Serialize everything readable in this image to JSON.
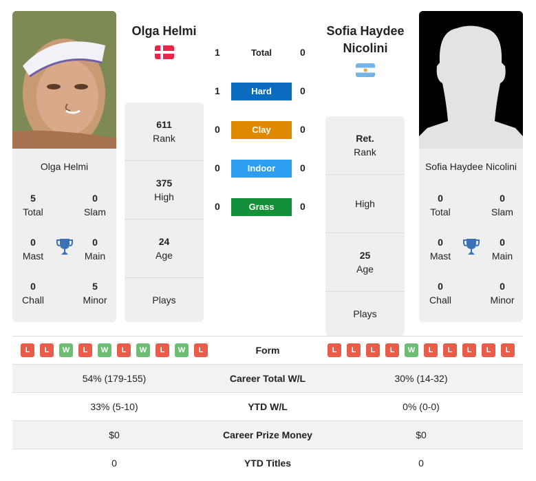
{
  "colors": {
    "hard": "#0a6bbf",
    "clay": "#dd8a00",
    "indoor": "#2e9ff0",
    "grass": "#149138",
    "loss": "#e95c4a",
    "win": "#6dbd73",
    "trophy": "#3a72b8",
    "card_bg": "#efefef"
  },
  "player1": {
    "name": "Olga Helmi",
    "flag": "denmark-flag",
    "photo": "player-photo",
    "card_name": "Olga Helmi",
    "titles": {
      "total": {
        "value": "5",
        "label": "Total"
      },
      "slam": {
        "value": "0",
        "label": "Slam"
      },
      "mast": {
        "value": "0",
        "label": "Mast"
      },
      "main": {
        "value": "0",
        "label": "Main"
      },
      "chall": {
        "value": "0",
        "label": "Chall"
      },
      "minor": {
        "value": "5",
        "label": "Minor"
      }
    },
    "rank": {
      "value": "611",
      "label": "Rank"
    },
    "high": {
      "value": "375",
      "label": "High"
    },
    "age": {
      "value": "24",
      "label": "Age"
    },
    "plays": {
      "value": "",
      "label": "Plays"
    },
    "form": [
      "L",
      "L",
      "W",
      "L",
      "W",
      "L",
      "W",
      "L",
      "W",
      "L"
    ],
    "career_wl": "54% (179-155)",
    "ytd_wl": "33% (5-10)",
    "prize": "$0",
    "ytd_titles": "0"
  },
  "player2": {
    "name": "Sofia Haydee Nicolini",
    "name_line1": "Sofia Haydee",
    "name_line2": "Nicolini",
    "flag": "argentina-flag",
    "photo": "silhouette-placeholder",
    "card_name": "Sofia Haydee Nicolini",
    "titles": {
      "total": {
        "value": "0",
        "label": "Total"
      },
      "slam": {
        "value": "0",
        "label": "Slam"
      },
      "mast": {
        "value": "0",
        "label": "Mast"
      },
      "main": {
        "value": "0",
        "label": "Main"
      },
      "chall": {
        "value": "0",
        "label": "Chall"
      },
      "minor": {
        "value": "0",
        "label": "Minor"
      }
    },
    "rank": {
      "value": "Ret.",
      "label": "Rank"
    },
    "high": {
      "value": "",
      "label": "High"
    },
    "age": {
      "value": "25",
      "label": "Age"
    },
    "plays": {
      "value": "",
      "label": "Plays"
    },
    "form": [
      "L",
      "L",
      "L",
      "L",
      "W",
      "L",
      "L",
      "L",
      "L",
      "L"
    ],
    "career_wl": "30% (14-32)",
    "ytd_wl": "0% (0-0)",
    "prize": "$0",
    "ytd_titles": "0"
  },
  "h2h": [
    {
      "label": "Total",
      "p1": "1",
      "p2": "0"
    },
    {
      "label": "Hard",
      "p1": "1",
      "p2": "0"
    },
    {
      "label": "Clay",
      "p1": "0",
      "p2": "0"
    },
    {
      "label": "Indoor",
      "p1": "0",
      "p2": "0"
    },
    {
      "label": "Grass",
      "p1": "0",
      "p2": "0"
    }
  ],
  "table": {
    "form_label": "Form",
    "career_wl_label": "Career Total W/L",
    "ytd_wl_label": "YTD W/L",
    "prize_label": "Career Prize Money",
    "ytd_titles_label": "YTD Titles"
  }
}
